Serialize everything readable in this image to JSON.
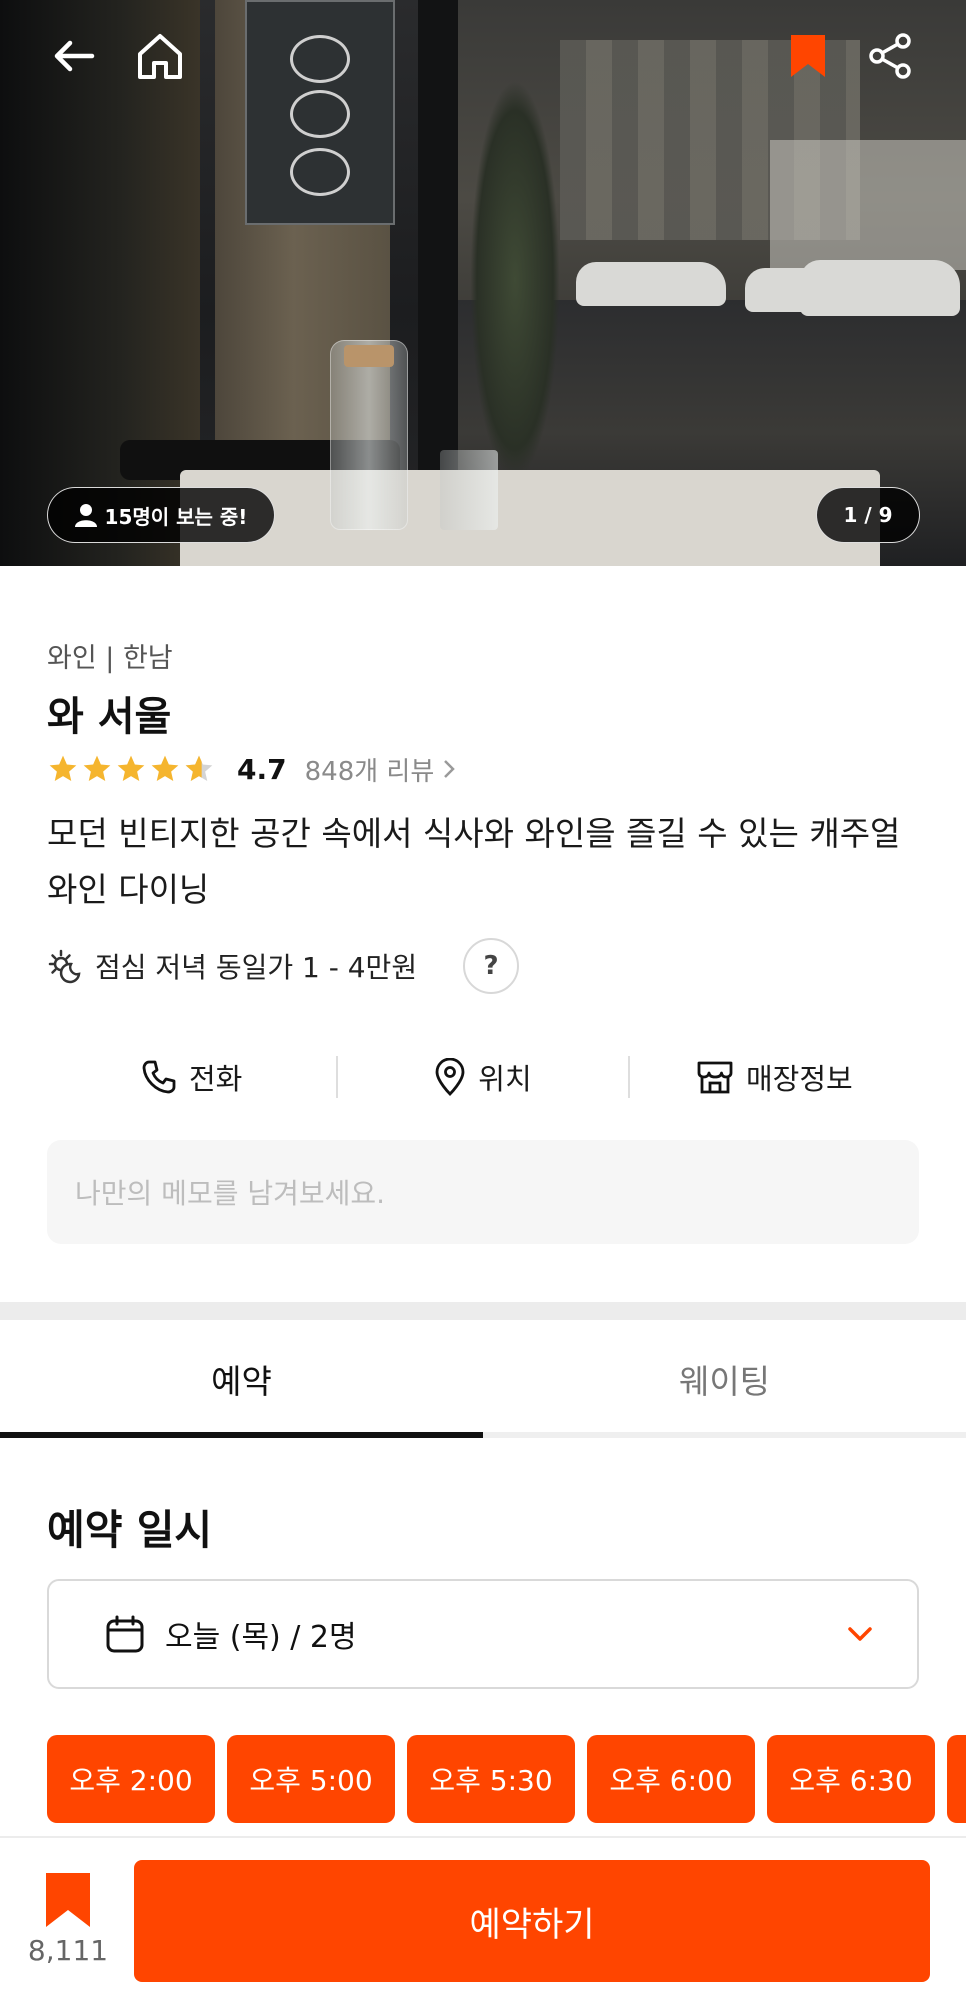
{
  "hero": {
    "viewers_text": "15명이 보는 중!",
    "photo_counter": "1 / 9",
    "icons": [
      "back-arrow-icon",
      "home-icon",
      "bookmark-icon",
      "share-icon",
      "person-icon"
    ]
  },
  "restaurant": {
    "category": "와인 | 한남",
    "name": "와 서울",
    "rating": "4.7",
    "stars": 4.7,
    "reviews": "848개 리뷰",
    "description": "모던 빈티지한 공간 속에서 식사와 와인을 즐길 수 있는 캐주얼 와인 다이닝",
    "price": "점심 저녁 동일가 1 - 4만원",
    "help": "?"
  },
  "actions": {
    "call": "전화",
    "location": "위치",
    "store_info": "매장정보"
  },
  "memo": {
    "placeholder": "나만의 메모를 남겨보세요."
  },
  "tabs": [
    {
      "label": "예약",
      "active": true
    },
    {
      "label": "웨이팅",
      "active": false
    }
  ],
  "reservation": {
    "section_title": "예약 일시",
    "date": "오늘 (목) / 2명",
    "slots": [
      "오후 2:00",
      "오후 5:00",
      "오후 5:30",
      "오후 6:00",
      "오후 6:30"
    ]
  },
  "bottom": {
    "save_count": "8,111",
    "reserve_label": "예약하기"
  },
  "colors": {
    "accent": "#ff4500",
    "star": "#f5b52e"
  }
}
